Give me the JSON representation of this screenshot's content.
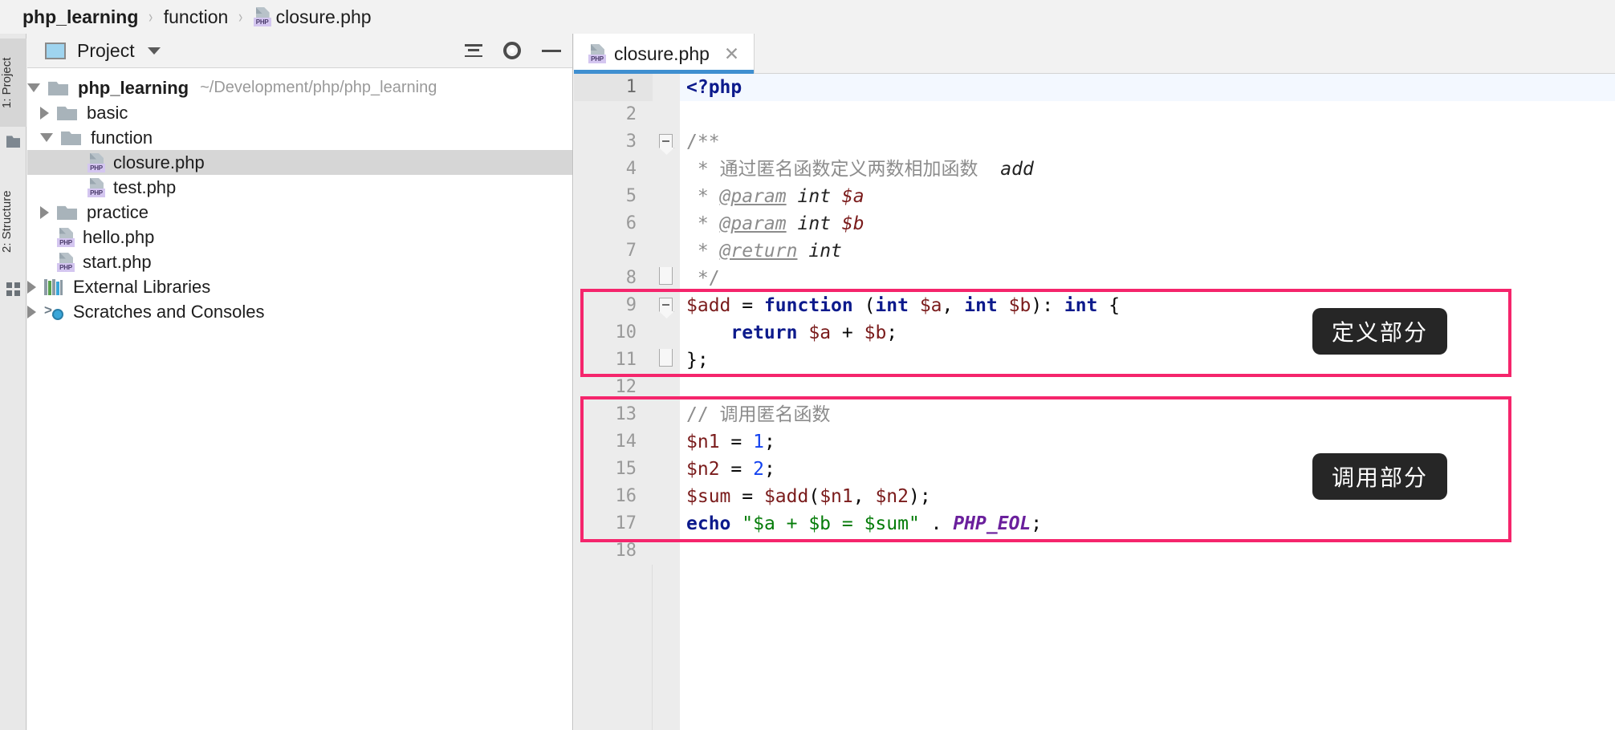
{
  "breadcrumb": {
    "items": [
      {
        "label": "php_learning",
        "icon": null,
        "bold": true
      },
      {
        "label": "function",
        "icon": null,
        "bold": false
      },
      {
        "label": "closure.php",
        "icon": "php-file-icon",
        "bold": false
      }
    ],
    "separator": "›"
  },
  "tool_strip": {
    "project_tab": "1: Project",
    "structure_tab": "2: Structure",
    "folder_icon": "folder-icon",
    "grid_icon": "grid-icon"
  },
  "project_panel": {
    "title": "Project",
    "title_icon": "project-icon",
    "dropdown_icon": "chevron-down-icon",
    "actions": [
      {
        "name": "collapse-all-button",
        "icon": "collapse-all-icon"
      },
      {
        "name": "settings-button",
        "icon": "gear-icon"
      },
      {
        "name": "hide-panel-button",
        "icon": "minimize-icon"
      }
    ],
    "tree": [
      {
        "label": "php_learning",
        "path": "~/Development/php/php_learning",
        "indent": 0,
        "twisty": "open",
        "icon": "folder-icon",
        "bold": true,
        "selected": false
      },
      {
        "label": "basic",
        "path": "",
        "indent": 1,
        "twisty": "closed",
        "icon": "folder-icon",
        "bold": false,
        "selected": false
      },
      {
        "label": "function",
        "path": "",
        "indent": 1,
        "twisty": "open",
        "icon": "folder-icon",
        "bold": false,
        "selected": false
      },
      {
        "label": "closure.php",
        "path": "",
        "indent": 2,
        "twisty": "none",
        "icon": "php-file-icon",
        "bold": false,
        "selected": true
      },
      {
        "label": "test.php",
        "path": "",
        "indent": 2,
        "twisty": "none",
        "icon": "php-file-icon",
        "bold": false,
        "selected": false
      },
      {
        "label": "practice",
        "path": "",
        "indent": 1,
        "twisty": "closed",
        "icon": "folder-icon",
        "bold": false,
        "selected": false
      },
      {
        "label": "hello.php",
        "path": "",
        "indent": 1,
        "twisty": "none",
        "icon": "php-file-icon",
        "bold": false,
        "selected": false
      },
      {
        "label": "start.php",
        "path": "",
        "indent": 1,
        "twisty": "none",
        "icon": "php-file-icon",
        "bold": false,
        "selected": false
      },
      {
        "label": "External Libraries",
        "path": "",
        "indent": 0,
        "twisty": "closed",
        "icon": "libraries-icon",
        "bold": false,
        "selected": false
      },
      {
        "label": "Scratches and Consoles",
        "path": "",
        "indent": 0,
        "twisty": "closed",
        "icon": "scratches-icon",
        "bold": false,
        "selected": false
      }
    ]
  },
  "editor": {
    "tab": {
      "name": "closure.php",
      "icon": "php-file-icon",
      "close_icon": "close-icon"
    },
    "current_line": 1,
    "lines": [
      {
        "n": "1",
        "fold": "",
        "tokens": [
          {
            "t": "<?php",
            "c": "t-kw"
          }
        ]
      },
      {
        "n": "2",
        "fold": "",
        "tokens": []
      },
      {
        "n": "3",
        "fold": "tip",
        "tokens": [
          {
            "t": "/**",
            "c": "t-cmt"
          }
        ]
      },
      {
        "n": "4",
        "fold": "",
        "tokens": [
          {
            "t": " * 通过匿名函数定义两数相加函数  ",
            "c": "t-cmt"
          },
          {
            "t": "add",
            "c": "t-doc-type"
          }
        ]
      },
      {
        "n": "5",
        "fold": "",
        "tokens": [
          {
            "t": " * ",
            "c": "t-cmt"
          },
          {
            "t": "@param",
            "c": "t-tag"
          },
          {
            "t": " ",
            "c": "t-cmt"
          },
          {
            "t": "int",
            "c": "t-doc-type"
          },
          {
            "t": " ",
            "c": "t-cmt"
          },
          {
            "t": "$a",
            "c": "t-doc-var"
          }
        ]
      },
      {
        "n": "6",
        "fold": "",
        "tokens": [
          {
            "t": " * ",
            "c": "t-cmt"
          },
          {
            "t": "@param",
            "c": "t-tag"
          },
          {
            "t": " ",
            "c": "t-cmt"
          },
          {
            "t": "int",
            "c": "t-doc-type"
          },
          {
            "t": " ",
            "c": "t-cmt"
          },
          {
            "t": "$b",
            "c": "t-doc-var"
          }
        ]
      },
      {
        "n": "7",
        "fold": "",
        "tokens": [
          {
            "t": " * ",
            "c": "t-cmt"
          },
          {
            "t": "@return",
            "c": "t-tag"
          },
          {
            "t": " ",
            "c": "t-cmt"
          },
          {
            "t": "int",
            "c": "t-doc-type"
          }
        ]
      },
      {
        "n": "8",
        "fold": "end",
        "tokens": [
          {
            "t": " */",
            "c": "t-cmt"
          }
        ]
      },
      {
        "n": "9",
        "fold": "tip",
        "tokens": [
          {
            "t": "$add",
            "c": "t-var"
          },
          {
            "t": " = ",
            "c": "t-op"
          },
          {
            "t": "function",
            "c": "t-kw"
          },
          {
            "t": " (",
            "c": "t-op"
          },
          {
            "t": "int",
            "c": "t-kw"
          },
          {
            "t": " ",
            "c": "t-op"
          },
          {
            "t": "$a",
            "c": "t-var"
          },
          {
            "t": ", ",
            "c": "t-op"
          },
          {
            "t": "int",
            "c": "t-kw"
          },
          {
            "t": " ",
            "c": "t-op"
          },
          {
            "t": "$b",
            "c": "t-var"
          },
          {
            "t": "): ",
            "c": "t-op"
          },
          {
            "t": "int",
            "c": "t-kw"
          },
          {
            "t": " {",
            "c": "t-op"
          }
        ]
      },
      {
        "n": "10",
        "fold": "",
        "tokens": [
          {
            "t": "    ",
            "c": "t-op"
          },
          {
            "t": "return",
            "c": "t-kw"
          },
          {
            "t": " ",
            "c": "t-op"
          },
          {
            "t": "$a",
            "c": "t-var"
          },
          {
            "t": " + ",
            "c": "t-op"
          },
          {
            "t": "$b",
            "c": "t-var"
          },
          {
            "t": ";",
            "c": "t-op"
          }
        ]
      },
      {
        "n": "11",
        "fold": "end",
        "tokens": [
          {
            "t": "};",
            "c": "t-op"
          }
        ]
      },
      {
        "n": "12",
        "fold": "",
        "tokens": []
      },
      {
        "n": "13",
        "fold": "",
        "tokens": [
          {
            "t": "// 调用匿名函数",
            "c": "t-cmt"
          }
        ]
      },
      {
        "n": "14",
        "fold": "",
        "tokens": [
          {
            "t": "$n1",
            "c": "t-var"
          },
          {
            "t": " = ",
            "c": "t-op"
          },
          {
            "t": "1",
            "c": "t-num"
          },
          {
            "t": ";",
            "c": "t-op"
          }
        ]
      },
      {
        "n": "15",
        "fold": "",
        "tokens": [
          {
            "t": "$n2",
            "c": "t-var"
          },
          {
            "t": " = ",
            "c": "t-op"
          },
          {
            "t": "2",
            "c": "t-num"
          },
          {
            "t": ";",
            "c": "t-op"
          }
        ]
      },
      {
        "n": "16",
        "fold": "",
        "tokens": [
          {
            "t": "$sum",
            "c": "t-var"
          },
          {
            "t": " = ",
            "c": "t-op"
          },
          {
            "t": "$add",
            "c": "t-var"
          },
          {
            "t": "(",
            "c": "t-op"
          },
          {
            "t": "$n1",
            "c": "t-var"
          },
          {
            "t": ", ",
            "c": "t-op"
          },
          {
            "t": "$n2",
            "c": "t-var"
          },
          {
            "t": ");",
            "c": "t-op"
          }
        ]
      },
      {
        "n": "17",
        "fold": "",
        "tokens": [
          {
            "t": "echo",
            "c": "t-kw"
          },
          {
            "t": " ",
            "c": "t-op"
          },
          {
            "t": "\"$a + $b = $sum\"",
            "c": "t-str"
          },
          {
            "t": " . ",
            "c": "t-op"
          },
          {
            "t": "PHP_EOL",
            "c": "t-const"
          },
          {
            "t": ";",
            "c": "t-op"
          }
        ]
      },
      {
        "n": "18",
        "fold": "",
        "tokens": []
      }
    ]
  },
  "annotations": {
    "accent_color": "#f5256c",
    "label_bg": "#262626",
    "boxes": [
      {
        "label": "定义部分",
        "name": "definition-annotation"
      },
      {
        "label": "调用部分",
        "name": "usage-annotation"
      }
    ]
  }
}
